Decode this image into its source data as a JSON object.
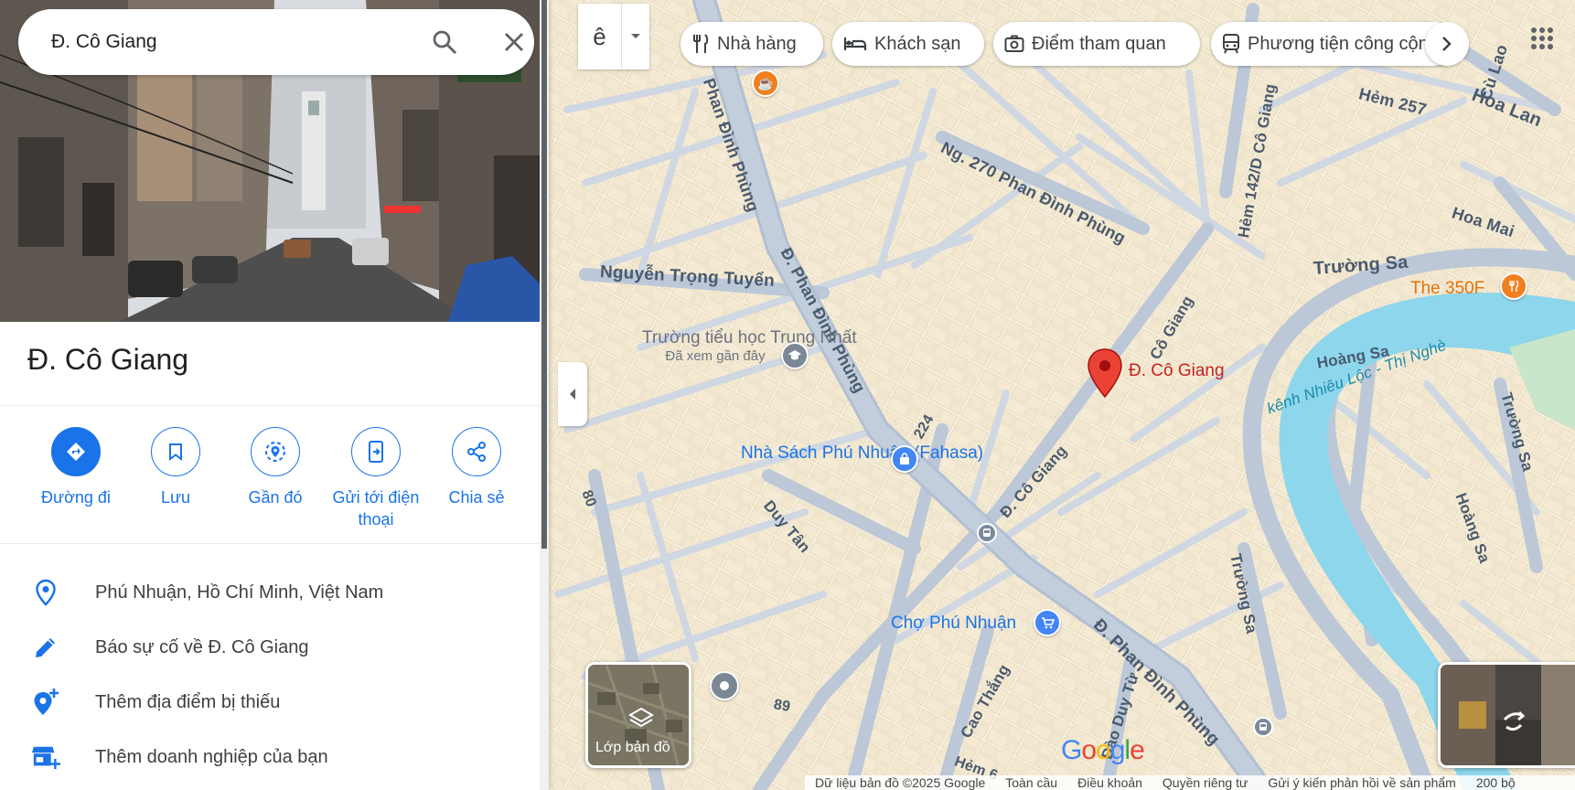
{
  "search": {
    "value": "Đ. Cô Giang"
  },
  "place": {
    "title": "Đ. Cô Giang"
  },
  "actions": [
    {
      "label": "Đường đi",
      "icon": "directions-icon"
    },
    {
      "label": "Lưu",
      "icon": "bookmark-icon"
    },
    {
      "label": "Gần đó",
      "icon": "nearby-icon"
    },
    {
      "label": "Gửi tới điện thoại",
      "icon": "send-to-phone-icon"
    },
    {
      "label": "Chia sẻ",
      "icon": "share-icon"
    }
  ],
  "info": [
    {
      "text": "Phú Nhuận, Hồ Chí Minh, Việt Nam",
      "icon": "location-pin-icon"
    },
    {
      "text": "Báo sự cố về Đ. Cô Giang",
      "icon": "edit-pencil-icon"
    },
    {
      "text": "Thêm địa điểm bị thiếu",
      "icon": "add-place-icon"
    },
    {
      "text": "Thêm doanh nghiệp của bạn",
      "icon": "add-business-icon"
    }
  ],
  "map_toolbar": {
    "language_glyph": "ê",
    "chips": [
      {
        "label": "Nhà hàng",
        "icon": "restaurant-icon"
      },
      {
        "label": "Khách sạn",
        "icon": "hotel-icon"
      },
      {
        "label": "Điểm tham quan",
        "icon": "camera-icon"
      },
      {
        "label": "Phương tiện công cộng",
        "icon": "transit-icon"
      }
    ]
  },
  "map": {
    "selected_marker": "Đ. Cô Giang",
    "streets": [
      "Ng. 270 Phan Đình Phùng",
      "Hẻm 142/D Cô Giang",
      "Hẻm 257",
      "Cù Lao",
      "Hoa Lan",
      "Hoa Mai",
      "Nguyễn Trọng Tuyển",
      "Đ. Phan Đình Phùng",
      "Phan Đình Phùng",
      "Trường Sa",
      "Cô Giang",
      "Đ. Cô Giang",
      "224",
      "Duy Tân",
      "80",
      "89",
      "Cao Thắng",
      "Đào Duy Từ",
      "Hoàng Sa",
      "Trường Sa",
      "Đ. Phan Đình Phùng",
      "Hẻm 6",
      "kênh Nhiêu Lộc - Thị Nghè",
      "Hoàng Sa",
      "Trường Sa"
    ],
    "pois": [
      {
        "name": "Trường tiểu học Trung Nhất",
        "sub": "Đã xem gần đây"
      },
      {
        "name": "Nhà Sách Phú Nhuận (Fahasa)"
      },
      {
        "name": "Chợ Phú Nhuận"
      },
      {
        "name": "The 350F"
      }
    ],
    "layers_label": "Lớp bản đồ",
    "google_logo": "Google"
  },
  "footer": [
    "Dữ liệu bản đồ ©2025 Google",
    "Toàn cầu",
    "Điều khoản",
    "Quyền riêng tư",
    "Gửi ý kiến phản hồi về sản phẩm",
    "200 bộ"
  ],
  "colors": {
    "accent": "#1a73e8",
    "map_bg": "#f8f0dc",
    "road": "#c6d0de",
    "water": "#8dd6ec",
    "marker": "#ea4335"
  }
}
